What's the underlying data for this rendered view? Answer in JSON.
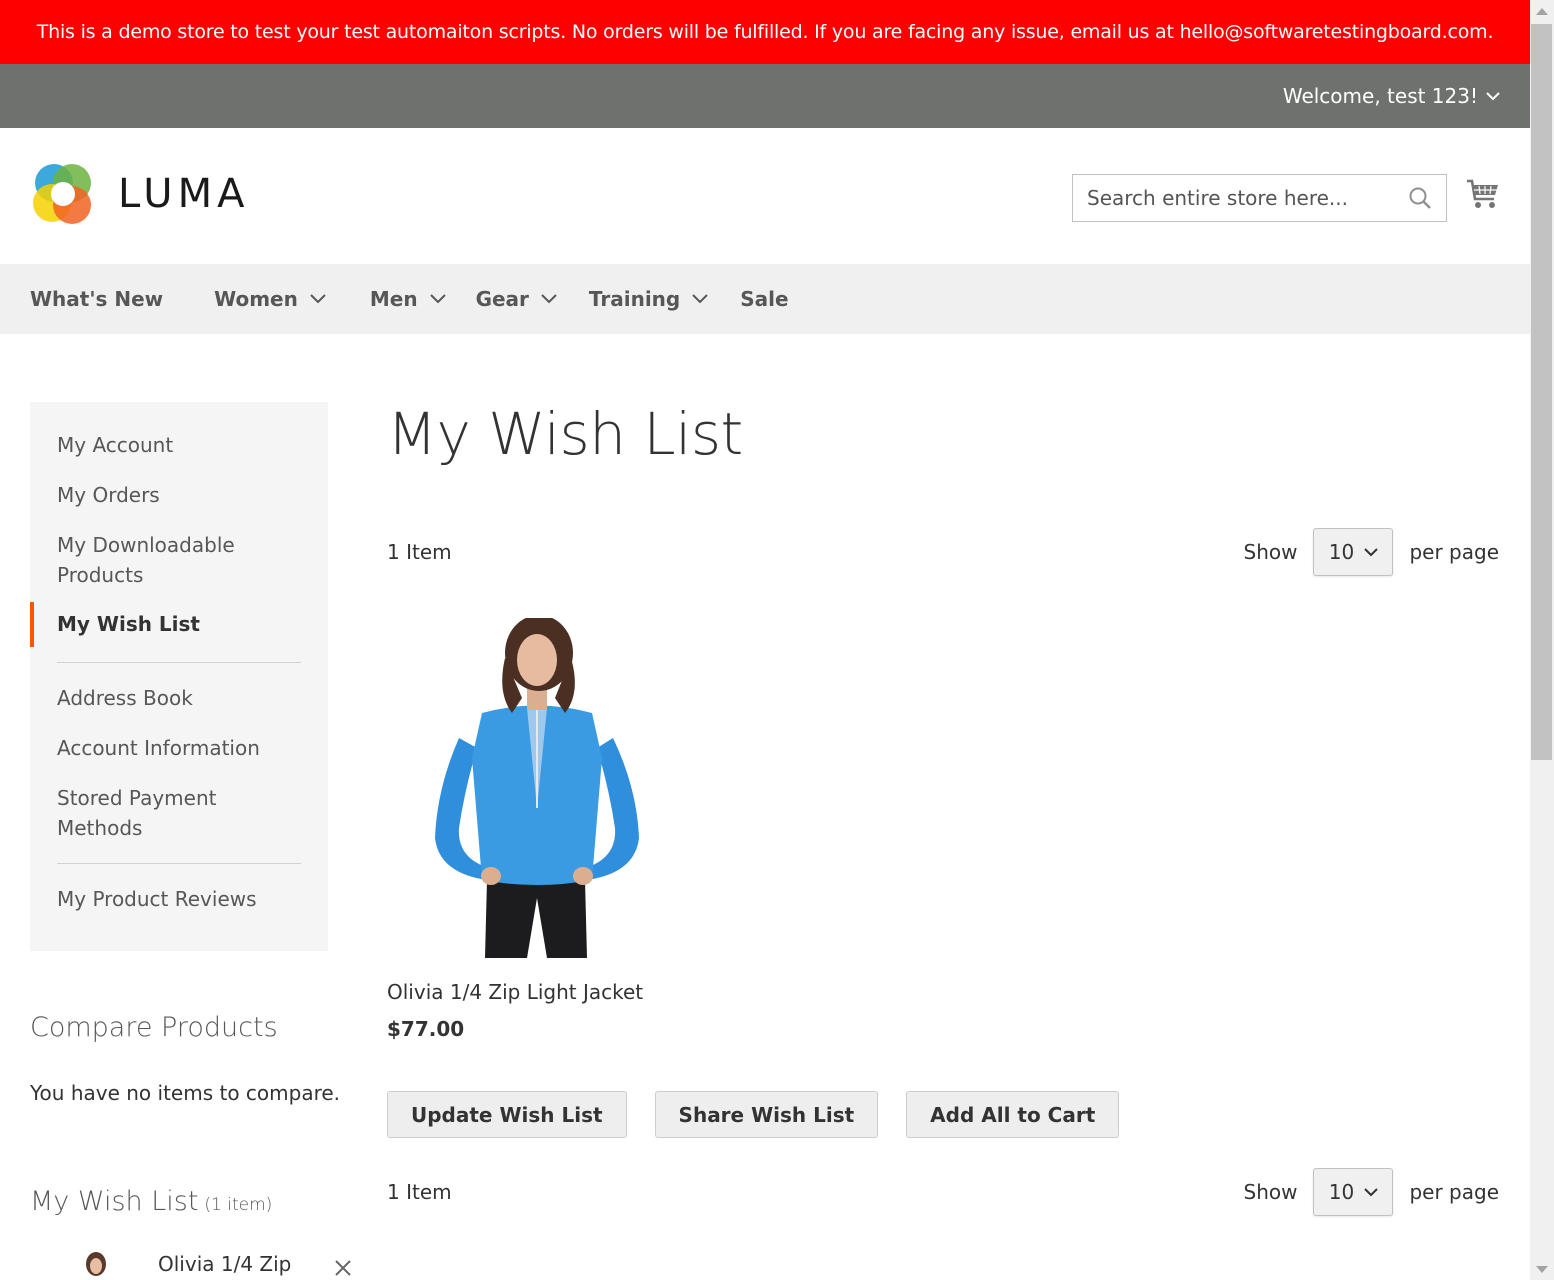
{
  "banner": {
    "text": "This is a demo store to test your test automaiton scripts. No orders will be fulfilled. If you are facing any issue, email us at hello@softwaretestingboard.com."
  },
  "header": {
    "welcome": "Welcome, test 123!",
    "logo_text": "LUMA",
    "search_placeholder": "Search entire store here..."
  },
  "nav": {
    "items": [
      {
        "label": "What's New"
      },
      {
        "label": "Women"
      },
      {
        "label": "Men"
      },
      {
        "label": "Gear"
      },
      {
        "label": "Training"
      },
      {
        "label": "Sale"
      }
    ]
  },
  "sidebar": {
    "items": [
      {
        "label": "My Account"
      },
      {
        "label": "My Orders"
      },
      {
        "label": "My Downloadable Products"
      },
      {
        "label": "My Wish List"
      },
      {
        "label": "Address Book"
      },
      {
        "label": "Account Information"
      },
      {
        "label": "Stored Payment Methods"
      },
      {
        "label": "My Product Reviews"
      }
    ],
    "active": "My Wish List"
  },
  "compare": {
    "title": "Compare Products",
    "empty": "You have no items to compare."
  },
  "wishlist_block": {
    "title": "My Wish List",
    "count": "(1 item)",
    "item_name": "Olivia 1/4 Zip"
  },
  "main": {
    "title": "My Wish List",
    "toolbar_top": {
      "count": "1 Item",
      "show": "Show",
      "limit": "10",
      "per_page": "per page"
    },
    "toolbar_bottom": {
      "count": "1 Item",
      "show": "Show",
      "limit": "10",
      "per_page": "per page"
    },
    "product": {
      "name": "Olivia 1/4 Zip Light Jacket",
      "price": "$77.00"
    },
    "buttons": {
      "update": "Update Wish List",
      "share": "Share Wish List",
      "add_all": "Add All to Cart"
    }
  },
  "colors": {
    "banner": "#ff0000",
    "welcome_bar": "#6e716e",
    "active_marker": "#ff5501",
    "nav_bg": "#f0f0f0"
  }
}
